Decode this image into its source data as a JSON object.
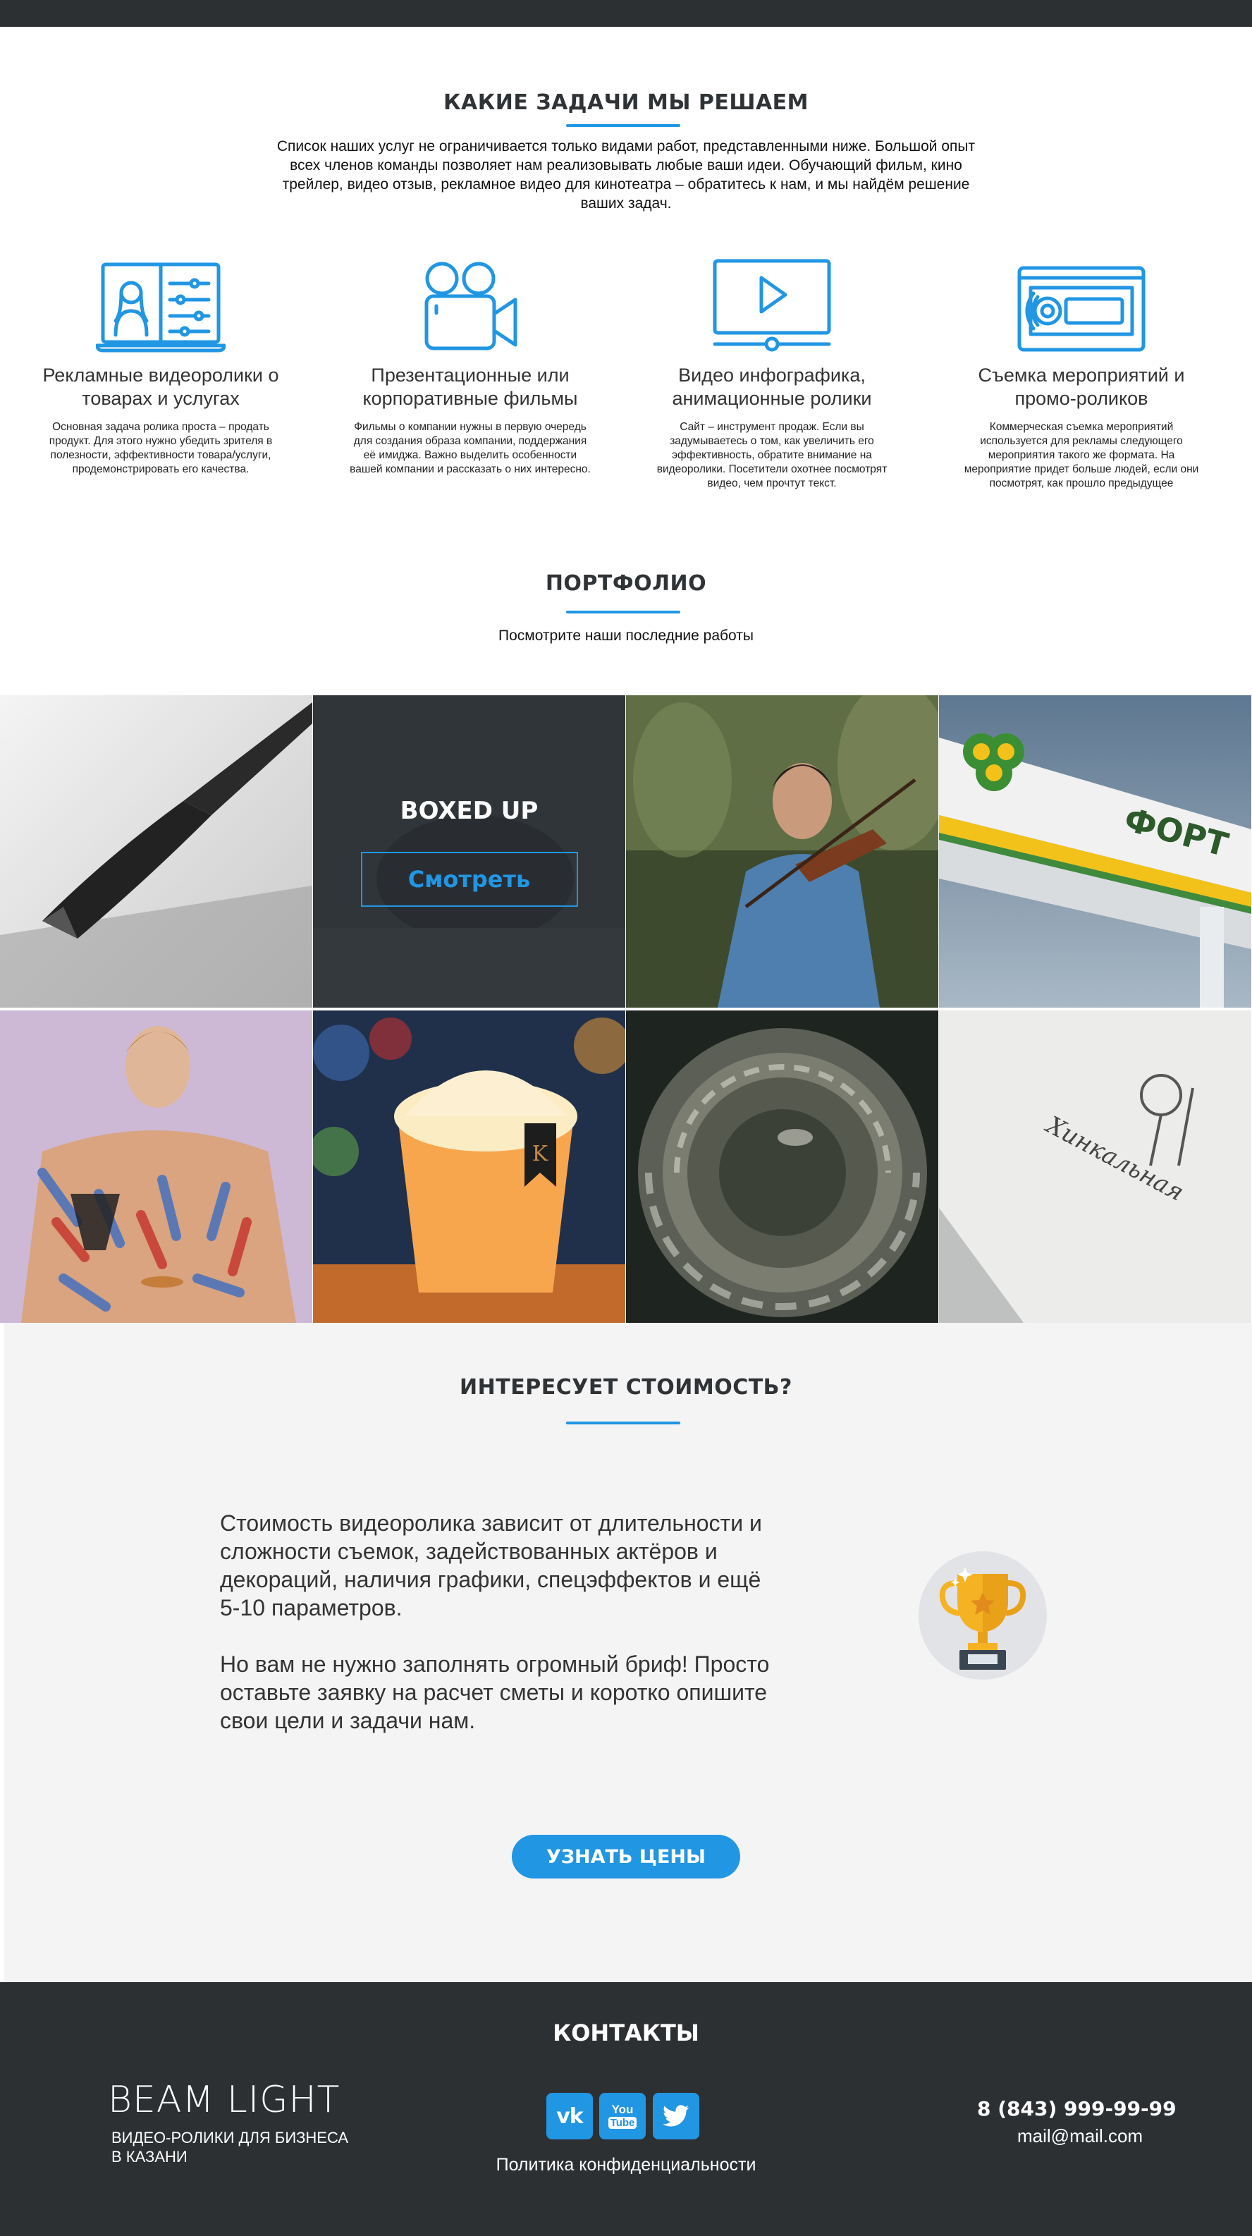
{
  "services": {
    "title": "КАКИЕ ЗАДАЧИ МЫ РЕШАЕМ",
    "description": "Список наших услуг не ограничивается только видами работ, представленными ниже. Большой опыт всех членов команды позволяет нам реализовывать любые ваши идеи. Обучающий фильм, кино трейлер, видео отзыв, рекламное видео для кинотеатра – обратитесь к нам, и мы найдём решение ваших задач.",
    "items": [
      {
        "icon": "laptop-presenter-icon",
        "title": "Рекламные видеоролики о товарах и услугах",
        "text": "Основная задача ролика проста – продать продукт. Для этого нужно убедить зрителя в полезности, эффективности товара/услуги, продемонстрировать его качества."
      },
      {
        "icon": "video-camera-icon",
        "title": "Презентационные или корпоративные фильмы",
        "text": "Фильмы о компании нужны в первую очередь для создания образа компании, поддержания её имиджа. Важно выделить особенности вашей компании и рассказать о них интересно."
      },
      {
        "icon": "video-player-icon",
        "title": "Видео инфографика, анимационные ролики",
        "text": "Сайт – инструмент продаж. Если вы задумываетесь о том, как увеличить его эффективность, обратите внимание на видеоролики. Посетители охотнее посмотрят видео, чем прочтут текст."
      },
      {
        "icon": "video-cassette-icon",
        "title": "Съемка мероприятий и промо-роликов",
        "text": "Коммерческая съемка мероприятий используется для рекламы следующего мероприятия такого же формата. На мероприятие придет больше людей, если они посмотрят, как прошло предыдущее"
      }
    ]
  },
  "portfolio": {
    "title": "ПОРТФОЛИО",
    "subtitle": "Посмотрите наши последние работы",
    "hover_title": "BOXED UP",
    "hover_button": "Смотреть",
    "sign_text": "ФОРТ",
    "menu_text": "Хинкальная",
    "cup_letter": "K"
  },
  "pricing": {
    "title": "ИНТЕРЕСУЕТ СТОИМОСТЬ?",
    "paragraph1": "Стоимость видеоролика зависит от длительности и сложности съемок, задействованных актёров и декораций, наличия графики, спецэффектов и ещё 5-10 параметров.",
    "paragraph2": "Но вам не нужно заполнять огромный бриф! Просто оставьте заявку на расчет сметы и коротко опишите свои цели и задачи нам.",
    "button": "УЗНАТЬ ЦЕНЫ",
    "icon": "trophy-icon"
  },
  "footer": {
    "title": "КОНТАКТЫ",
    "brand": "BEAM LIGHT",
    "tagline_line1": "ВИДЕО-РОЛИКИ ДЛЯ БИЗНЕСА",
    "tagline_line2": "В КАЗАНИ",
    "social": [
      {
        "icon": "vk-icon",
        "label": "vk"
      },
      {
        "icon": "youtube-icon",
        "label_top": "You",
        "label_bottom": "Tube"
      },
      {
        "icon": "twitter-icon"
      }
    ],
    "privacy": "Политика конфиденциальности",
    "phone": "8 (843) 999-99-99",
    "email": "mail@mail.com"
  },
  "colors": {
    "accent": "#2196e3",
    "dark": "#2c3033",
    "light_bg": "#f4f4f4"
  }
}
